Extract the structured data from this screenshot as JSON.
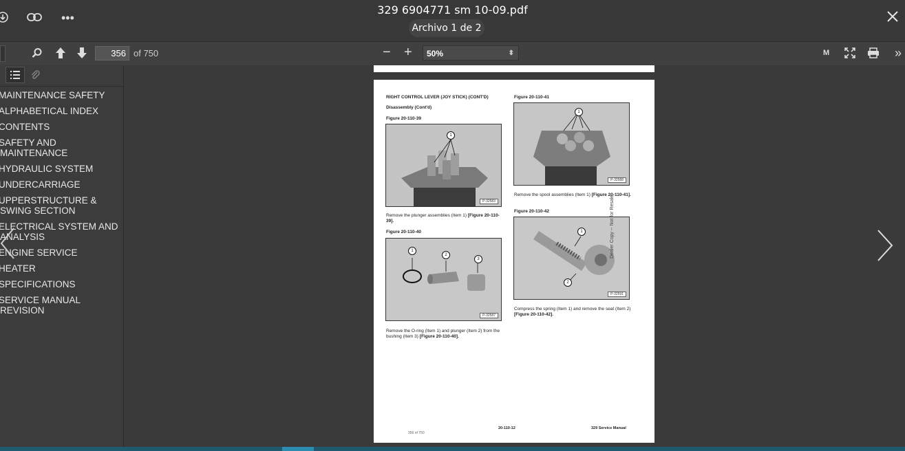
{
  "window": {
    "title": "329 6904771 sm 10-09.pdf",
    "file_counter": "Archivo 1 de 2"
  },
  "toolbar": {
    "page_number": "356",
    "page_total": "of 750",
    "zoom": "50%",
    "mode_label": "M"
  },
  "sidebar": {
    "items": [
      "MAINTENANCE SAFETY",
      "ALPHABETICAL INDEX",
      "CONTENTS",
      "SAFETY AND MAINTENANCE",
      "HYDRAULIC SYSTEM",
      "UNDERCARRIAGE",
      "UPPERSTRUCTURE & SWING SECTION",
      "ELECTRICAL SYSTEM AND ANALYSIS",
      "ENGINE SERVICE",
      "HEATER",
      "SPECIFICATIONS",
      "SERVICE MANUAL REVISION"
    ]
  },
  "document": {
    "heading": "RIGHT CONTROL LEVER (JOY STICK) (CONT'D)",
    "subheading": "Disassembly (Cont'd)",
    "fig39_label": "Figure 20-110-39",
    "fig39_code": "P-32583",
    "fig39_caption_plain": "Remove the plunger assemblies (Item 1) ",
    "fig39_caption_ref": "[Figure 20-110-39].",
    "fig40_label": "Figure 20-110-40",
    "fig40_code": "P-32587",
    "fig40_caption_plain": "Remove the O-ring (Item 1) and plunger (Item 2) from the bushing (Item 3) ",
    "fig40_caption_ref": "[Figure 20-110-40].",
    "fig41_label": "Figure 20-110-41",
    "fig41_code": "P-32588",
    "fig41_caption_plain": "Remove the spool assemblies (Item 1) ",
    "fig41_caption_ref": "[Figure 20-110-41].",
    "fig42_label": "Figure 20-110-42",
    "fig42_code": "P-32591",
    "fig42_caption_plain": "Compress the spring (Item 1) and remove the seat (Item 2) ",
    "fig42_caption_ref": "[Figure 20-110-42].",
    "side_note": "Dealer Copy -- Not for Resale",
    "footer_page": "356 of 750",
    "footer_number": "20-110-12",
    "footer_manual": "329 Service Manual",
    "callouts": [
      "1",
      "2",
      "3"
    ]
  },
  "icons": {
    "download": "download-icon",
    "link": "link-icon",
    "more": "more-icon",
    "close": "close-icon",
    "search": "search-icon",
    "up": "arrow-up-icon",
    "down": "arrow-down-icon",
    "fullscreen": "fullscreen-icon",
    "print": "print-icon",
    "expand": "double-chevron-icon"
  },
  "colors": {
    "accent": "#2b8cb0"
  }
}
